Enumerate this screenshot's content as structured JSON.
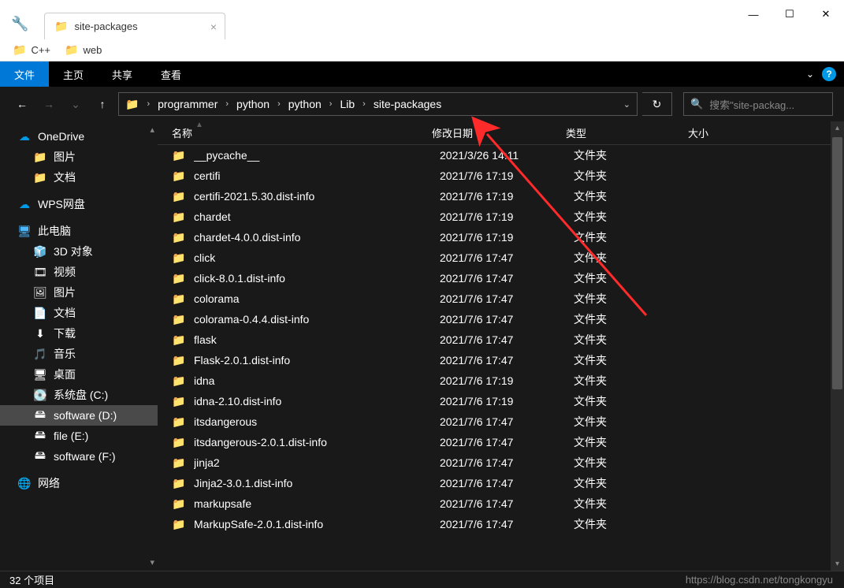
{
  "window": {
    "tab_title": "site-packages",
    "min": "—",
    "max": "☐",
    "close": "✕"
  },
  "bookmarks": [
    {
      "label": "C++"
    },
    {
      "label": "web"
    }
  ],
  "ribbon": {
    "file": "文件",
    "home": "主页",
    "share": "共享",
    "view": "查看"
  },
  "nav": {
    "crumbs": [
      "programmer",
      "python",
      "python",
      "Lib",
      "site-packages"
    ],
    "search_placeholder": "搜索\"site-packag..."
  },
  "sidebar": {
    "onedrive": "OneDrive",
    "onedrive_children": [
      "图片",
      "文档"
    ],
    "wps": "WPS网盘",
    "thispc": "此电脑",
    "thispc_children": [
      {
        "label": "3D 对象",
        "icon": "🧊"
      },
      {
        "label": "视频",
        "icon": "🎞"
      },
      {
        "label": "图片",
        "icon": "🖼"
      },
      {
        "label": "文档",
        "icon": "📄"
      },
      {
        "label": "下载",
        "icon": "⬇"
      },
      {
        "label": "音乐",
        "icon": "🎵"
      },
      {
        "label": "桌面",
        "icon": "🖥"
      },
      {
        "label": "系统盘 (C:)",
        "icon": "💽"
      },
      {
        "label": "software (D:)",
        "icon": "🖴"
      },
      {
        "label": "file (E:)",
        "icon": "🖴"
      },
      {
        "label": "software (F:)",
        "icon": "🖴"
      }
    ],
    "network": "网络"
  },
  "columns": {
    "name": "名称",
    "date": "修改日期",
    "type": "类型",
    "size": "大小"
  },
  "files": [
    {
      "name": "__pycache__",
      "date": "2021/3/26 14:11",
      "type": "文件夹"
    },
    {
      "name": "certifi",
      "date": "2021/7/6 17:19",
      "type": "文件夹"
    },
    {
      "name": "certifi-2021.5.30.dist-info",
      "date": "2021/7/6 17:19",
      "type": "文件夹"
    },
    {
      "name": "chardet",
      "date": "2021/7/6 17:19",
      "type": "文件夹"
    },
    {
      "name": "chardet-4.0.0.dist-info",
      "date": "2021/7/6 17:19",
      "type": "文件夹"
    },
    {
      "name": "click",
      "date": "2021/7/6 17:47",
      "type": "文件夹"
    },
    {
      "name": "click-8.0.1.dist-info",
      "date": "2021/7/6 17:47",
      "type": "文件夹"
    },
    {
      "name": "colorama",
      "date": "2021/7/6 17:47",
      "type": "文件夹"
    },
    {
      "name": "colorama-0.4.4.dist-info",
      "date": "2021/7/6 17:47",
      "type": "文件夹"
    },
    {
      "name": "flask",
      "date": "2021/7/6 17:47",
      "type": "文件夹"
    },
    {
      "name": "Flask-2.0.1.dist-info",
      "date": "2021/7/6 17:47",
      "type": "文件夹"
    },
    {
      "name": "idna",
      "date": "2021/7/6 17:19",
      "type": "文件夹"
    },
    {
      "name": "idna-2.10.dist-info",
      "date": "2021/7/6 17:19",
      "type": "文件夹"
    },
    {
      "name": "itsdangerous",
      "date": "2021/7/6 17:47",
      "type": "文件夹"
    },
    {
      "name": "itsdangerous-2.0.1.dist-info",
      "date": "2021/7/6 17:47",
      "type": "文件夹"
    },
    {
      "name": "jinja2",
      "date": "2021/7/6 17:47",
      "type": "文件夹"
    },
    {
      "name": "Jinja2-3.0.1.dist-info",
      "date": "2021/7/6 17:47",
      "type": "文件夹"
    },
    {
      "name": "markupsafe",
      "date": "2021/7/6 17:47",
      "type": "文件夹"
    },
    {
      "name": "MarkupSafe-2.0.1.dist-info",
      "date": "2021/7/6 17:47",
      "type": "文件夹"
    }
  ],
  "status": {
    "count": "32 个项目",
    "watermark": "https://blog.csdn.net/tongkongyu"
  }
}
